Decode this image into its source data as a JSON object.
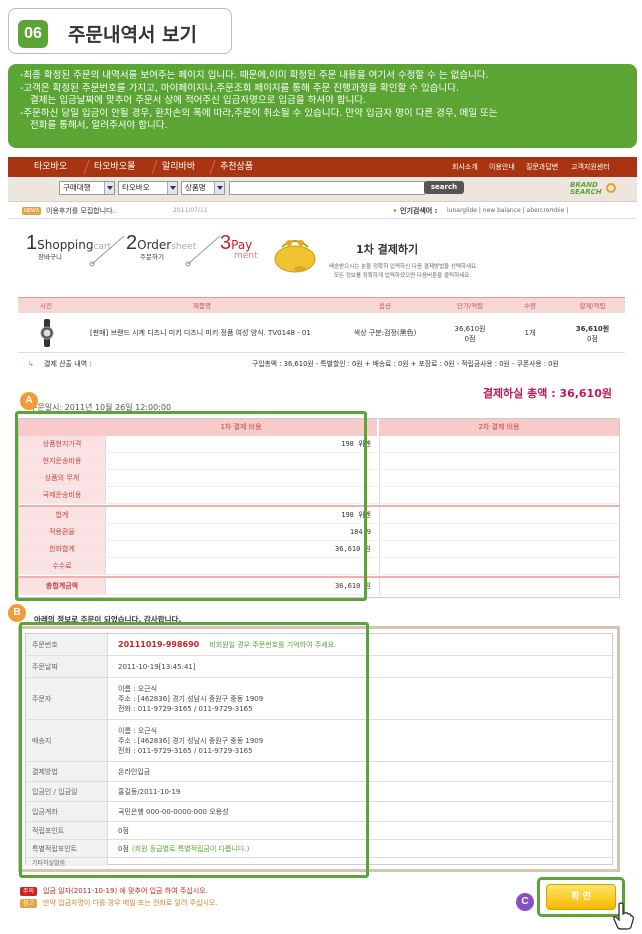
{
  "header": {
    "number": "06",
    "title": "주문내역서 보기"
  },
  "notice": {
    "lines": [
      "-최종 확정된 주문의 내역서를 보여주는 페이지 입니다. 때문에,이미 확정된 주문 내용을 여기서 수정할 수 는 없습니다.",
      "-고객은 확정된 주문번호를 가지고, 마이페이지나,주문조회 페이지를 통해 주문 진행과정을 확인할 수 있습니다.",
      "  결제는 입금날짜에 맞추어 주문서 상에 적어주신 입금자명으로 입금을 하셔야 합니다.",
      "-주문하신 당일 입금이 안될 경우, 환차손의 폭에 따라,주문이 취소될 수 있습니다.  만약 입금자 명이 다른 경우, 메일 또는",
      "  전화를 통해서, 알려주셔야 합니다."
    ]
  },
  "nav": {
    "tabs": [
      "타오바오",
      "타오바오몰",
      "알리바바",
      "추천상품"
    ],
    "right": [
      "회사소개",
      "이용안내",
      "질문과답변",
      "고객지원센터"
    ]
  },
  "search": {
    "select1": "구매대행",
    "select2": "타오바오",
    "select3": "상품명",
    "button": "search",
    "brand_line1": "BRAND",
    "brand_line2": "SEARCH"
  },
  "newsbar": {
    "badge": "NEWS",
    "text": "이용후기를 모집합니다.",
    "date": "2011/07/11",
    "keyword_label": "인기검색어 :",
    "keywords": "lunarglide | new balance | abercrombie |"
  },
  "steps": [
    {
      "num": "1",
      "title": "Shopping",
      "title2": "cart",
      "sub": "장바구니"
    },
    {
      "num": "2",
      "title": "Order",
      "title2": "sheet",
      "sub": "주문하기"
    },
    {
      "num": "3",
      "title": "Pay",
      "title2": "ment",
      "sub": ""
    }
  ],
  "payment": {
    "title": "1차 결제하기",
    "desc1": "배송받으시는 분을 정확히 입력하신 다음 결제방법을 선택하세요.",
    "desc2": "모든 정보를 정확하게 입력하셨으면 다음버튼을 클릭하세요."
  },
  "product_table": {
    "headers": [
      "사진",
      "제품명",
      "옵션",
      "단가/적립",
      "수량",
      "합계/적립"
    ],
    "row": {
      "name": "[판매] 브랜드 시계 디즈니 미키 디즈니 미키 정품 여성 양식. TV0148 - 01",
      "option": "색상 구분:검정(黑色)",
      "unit_price": "36,610원",
      "unit_point": "0점",
      "qty": "1개",
      "total": "36,610원",
      "total_point": "0점"
    }
  },
  "calc": {
    "label": "결제 산출 내역 :",
    "text": "구입총액 : 36,610원 - 특별할인 : 0원 + 배송료 : 0원 + 포장료 : 0원 - 적립금사용 : 0원 - 쿠폰사용 : 0원"
  },
  "total_pay": "결제하실 총액 : 36,610원",
  "order_date": "주문일시: 2011년 10월 26일    12:00:00",
  "cost": {
    "header1": "1차 결제 비용",
    "header2": "2차 결제 비용",
    "rows": [
      {
        "label": "상품현지가격",
        "value": "198 위엔"
      },
      {
        "label": "현지운송비용",
        "value": ""
      },
      {
        "label": "상품의 무게",
        "value": ""
      },
      {
        "label": "국제운송비용",
        "value": ""
      },
      {
        "label": "합계",
        "value": "198 위엔"
      },
      {
        "label": "적용환율",
        "value": "184.9"
      },
      {
        "label": "한화합계",
        "value": "36,610 원"
      },
      {
        "label": "수수료",
        "value": ""
      },
      {
        "label": "총합계금액",
        "value": "36,610 원"
      }
    ]
  },
  "markers": {
    "a": "A",
    "b": "B",
    "c": "C"
  },
  "thanks": "아래의 정보로 주문이 되었습니다. 감사합니다.",
  "info": {
    "order_no_label": "주문번호",
    "order_no": "20111019-998690",
    "order_no_note": "비회원일 경우 주문번호를 기억하여 주세요.",
    "date_label": "주문날짜",
    "date": "2011-10-19[13:45:41]",
    "orderer_label": "주문자",
    "orderer_name": "이름 : 오근식",
    "orderer_addr": "주소 : [462836] 경기 성남시 중원구 중동 1909",
    "orderer_tel": "전화 : 011-9729-3165 / 011-9729-3165",
    "ship_label": "배송지",
    "ship_name": "이름 : 오근식",
    "ship_addr": "주소 : [462836] 경기 성남시 중원구 중동 1909",
    "ship_tel": "전화 : 011-9729-3165 / 011-9729-3165",
    "method_label": "결제방법",
    "method": "온라인입금",
    "depositor_label": "입금인 / 입금일",
    "depositor": "홍길동/2011-10-19",
    "account_label": "입금계좌",
    "account": "국민은행 000-00-0000-000 오용성",
    "points_label": "적립포인트",
    "points": "0점",
    "special_label": "특별적립포인트",
    "special": "0점",
    "special_note": "(회원 등급별로 특별적립금이 다릅니다.)",
    "misc_label": "기타하실말씀",
    "misc": ""
  },
  "footer": {
    "badge1": "주의",
    "text1": "입금 일자(2011-10-19) 에 맞추어 입금 하여 주십시오.",
    "badge2": "참고",
    "text2": "만약 입금자명이 다를 경우 메일 또는 전화로 알려 주십시오."
  },
  "confirm": "확 인"
}
